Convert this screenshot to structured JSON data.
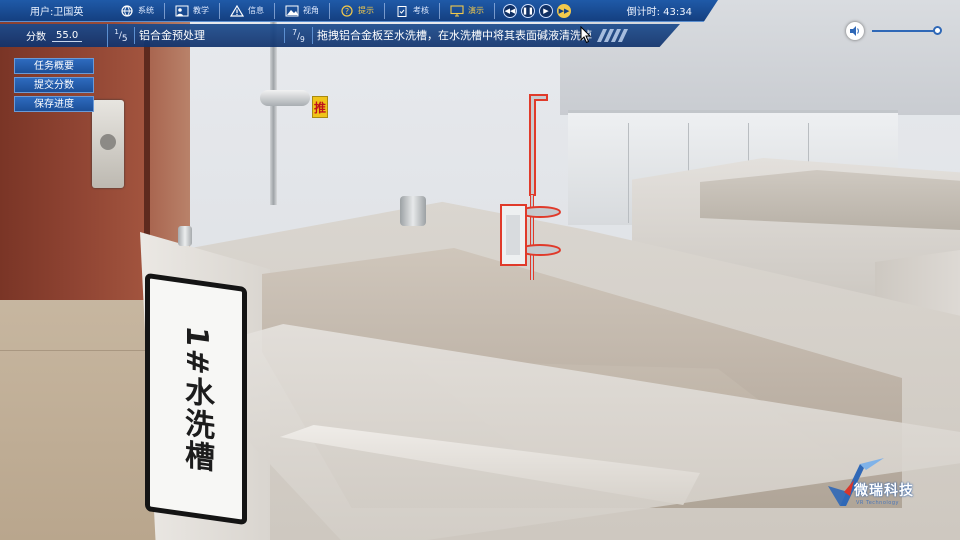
{
  "topbar": {
    "user_label": "用户:卫国英",
    "menu": [
      {
        "label": "系统",
        "icon": "globe-icon"
      },
      {
        "label": "教学",
        "icon": "teacher-icon"
      },
      {
        "label": "信息",
        "icon": "warning-icon"
      },
      {
        "label": "视角",
        "icon": "image-icon"
      },
      {
        "label": "提示",
        "icon": "help-icon"
      },
      {
        "label": "考核",
        "icon": "clipboard-icon"
      },
      {
        "label": "演示",
        "icon": "monitor-icon"
      }
    ],
    "media_controls": [
      "rewind",
      "pause",
      "play",
      "fast-forward"
    ],
    "timer_label": "倒计时: 43:34",
    "highlight_color": "#f2c94c",
    "bar_color": "#1a4a8e"
  },
  "subbar": {
    "score_label": "分数",
    "score_value": "55.0",
    "stage_current": "1",
    "stage_total": "5",
    "stage_name": "铝合金预处理",
    "step_current": "7",
    "step_total": "9",
    "step_instruction": "拖拽铝合金板至水洗槽，在水洗槽中将其表面碱液清洗掉"
  },
  "side_buttons": [
    "任务概要",
    "提交分数",
    "保存进度"
  ],
  "volume": {
    "level": 1.0
  },
  "scene": {
    "tank_label": "1#水洗槽",
    "wall_sign": "推",
    "highlight_outline_color": "#e03a2a"
  },
  "brand": {
    "name": "微瑞科技",
    "sub": "VR Technology"
  }
}
